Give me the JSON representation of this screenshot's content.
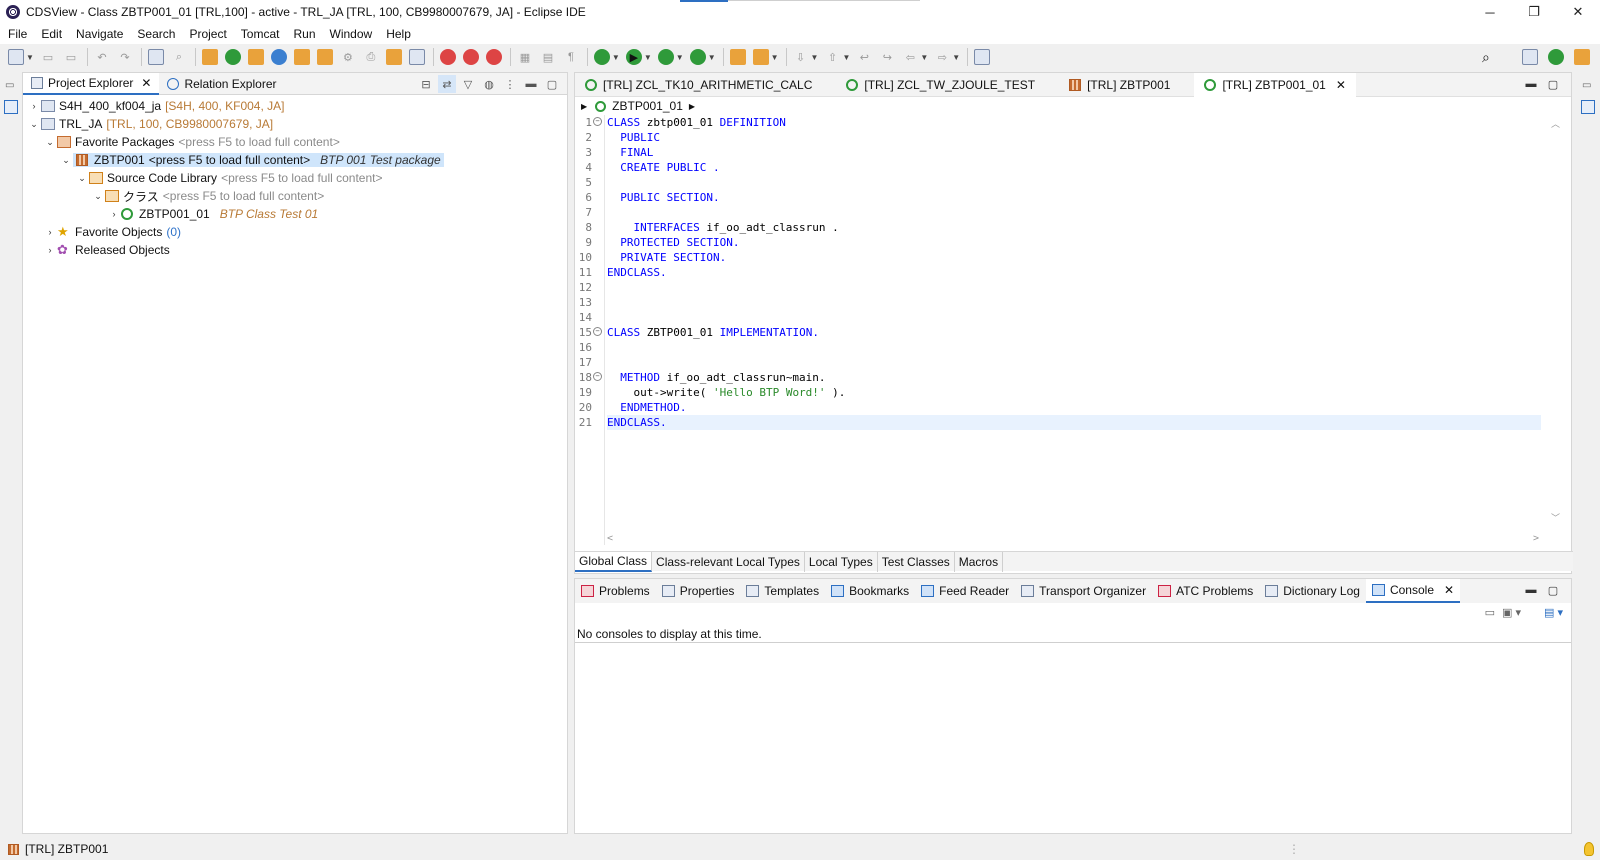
{
  "window": {
    "title": "CDSView - Class ZBTP001_01 [TRL,100] - active - TRL_JA [TRL, 100, CB9980007679, JA] - Eclipse IDE"
  },
  "menu": [
    "File",
    "Edit",
    "Navigate",
    "Search",
    "Project",
    "Tomcat",
    "Run",
    "Window",
    "Help"
  ],
  "explorer": {
    "tabs": [
      {
        "label": "Project Explorer",
        "icon": "project-explorer-icon",
        "active": true
      },
      {
        "label": "Relation Explorer",
        "icon": "relation-explorer-icon",
        "active": false
      }
    ],
    "tree": [
      {
        "label": "S4H_400_kf004_ja",
        "meta": "[S4H, 400, KF004, JA]"
      },
      {
        "label": "TRL_JA",
        "meta": "[TRL, 100, CB9980007679, JA]"
      },
      {
        "label": "Favorite Packages",
        "hint": "<press F5 to load full content>"
      },
      {
        "label": "ZBTP001",
        "hint": "<press F5 to load full content>",
        "desc": "BTP 001 Test package"
      },
      {
        "label": "Source Code Library",
        "hint": "<press F5 to load full content>"
      },
      {
        "label": "クラス",
        "hint": "<press F5 to load full content>"
      },
      {
        "label": "ZBTP001_01",
        "desc": "BTP Class Test 01"
      },
      {
        "label": "Favorite Objects",
        "count": "(0)"
      },
      {
        "label": "Released Objects"
      }
    ]
  },
  "editor": {
    "tabs": [
      {
        "label": "[TRL] ZCL_TK10_ARITHMETIC_CALC"
      },
      {
        "label": "[TRL] ZCL_TW_ZJOULE_TEST"
      },
      {
        "label": "[TRL] ZBTP001"
      },
      {
        "label": "[TRL] ZBTP001_01",
        "active": true
      }
    ],
    "breadcrumb": "ZBTP001_01",
    "line_numbers": [
      "1",
      "2",
      "3",
      "4",
      "5",
      "6",
      "7",
      "8",
      "9",
      "10",
      "11",
      "12",
      "13",
      "14",
      "15",
      "16",
      "17",
      "18",
      "19",
      "20",
      "21"
    ],
    "code": {
      "l1a": "CLASS",
      "l1b": " zbtp001_01 ",
      "l1c": "DEFINITION",
      "l2": "  PUBLIC",
      "l3": "  FINAL",
      "l4": "  CREATE PUBLIC .",
      "l6": "  PUBLIC SECTION.",
      "l8a": "    INTERFACES",
      "l8b": " if_oo_adt_classrun .",
      "l9": "  PROTECTED SECTION.",
      "l10": "  PRIVATE SECTION.",
      "l11": "ENDCLASS.",
      "l15a": "CLASS",
      "l15b": " ZBTP001_01 ",
      "l15c": "IMPLEMENTATION.",
      "l18a": "  METHOD",
      "l18b": " if_oo_adt_classrun~main.",
      "l19a": "    out->write( ",
      "l19b": "'Hello BTP Word!'",
      "l19c": " ).",
      "l20": "  ENDMETHOD.",
      "l21": "ENDCLASS."
    },
    "subtabs": [
      "Global Class",
      "Class-relevant Local Types",
      "Local Types",
      "Test Classes",
      "Macros"
    ]
  },
  "console": {
    "tabs": [
      {
        "label": "Problems"
      },
      {
        "label": "Properties"
      },
      {
        "label": "Templates"
      },
      {
        "label": "Bookmarks"
      },
      {
        "label": "Feed Reader"
      },
      {
        "label": "Transport Organizer"
      },
      {
        "label": "ATC Problems"
      },
      {
        "label": "Dictionary Log"
      },
      {
        "label": "Console",
        "active": true
      }
    ],
    "message": "No consoles to display at this time."
  },
  "status": {
    "text": "[TRL] ZBTP001"
  }
}
